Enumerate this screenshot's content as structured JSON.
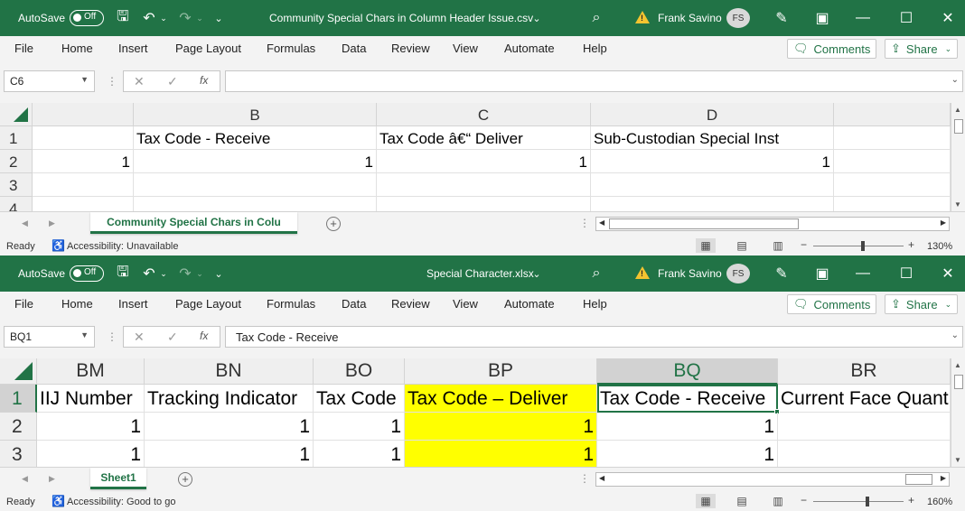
{
  "windows": [
    {
      "autosave_label": "AutoSave",
      "autosave_state": "Off",
      "title": "Community Special Chars in Column Header Issue.csv",
      "user": "Frank Savino",
      "avatar_initials": "FS",
      "menu": [
        "File",
        "Home",
        "Insert",
        "Page Layout",
        "Formulas",
        "Data",
        "Review",
        "View",
        "Automate",
        "Help"
      ],
      "comments_label": "Comments",
      "share_label": "Share",
      "name_box": "C6",
      "formula": "",
      "columns": [
        "B",
        "C",
        "D"
      ],
      "rows": [
        "1",
        "2",
        "3",
        "4"
      ],
      "cells": [
        [
          "",
          "Tax Code - Receive",
          "Tax Code â€“ Deliver",
          "Sub-Custodian Special Inst",
          ""
        ],
        [
          "1",
          "1",
          "1",
          "1",
          ""
        ],
        [
          "",
          "",
          "",
          "",
          ""
        ]
      ],
      "sheet_tab": "Community Special Chars in Colu",
      "status_ready": "Ready",
      "accessibility": "Accessibility: Unavailable",
      "zoom": "130%",
      "zoom_fraction": 0.55
    },
    {
      "autosave_label": "AutoSave",
      "autosave_state": "Off",
      "title": "Special Character.xlsx",
      "user": "Frank Savino",
      "avatar_initials": "FS",
      "menu": [
        "File",
        "Home",
        "Insert",
        "Page Layout",
        "Formulas",
        "Data",
        "Review",
        "View",
        "Automate",
        "Help"
      ],
      "comments_label": "Comments",
      "share_label": "Share",
      "name_box": "BQ1",
      "formula": "Tax Code - Receive",
      "columns": [
        "BM",
        "BN",
        "BO",
        "BP",
        "BQ",
        "BR"
      ],
      "rows": [
        "1",
        "2",
        "3"
      ],
      "cells": [
        [
          "IIJ Number",
          "Tracking Indicator",
          "Tax Code",
          "Tax Code – Deliver",
          "Tax Code - Receive",
          "Current Face Quanti"
        ],
        [
          "1",
          "1",
          "1",
          "1",
          "1",
          ""
        ],
        [
          "1",
          "1",
          "1",
          "1",
          "1",
          ""
        ]
      ],
      "sheet_tab": "Sheet1",
      "status_ready": "Ready",
      "accessibility": "Accessibility: Good to go",
      "zoom": "160%",
      "zoom_fraction": 0.6,
      "highlight_color": "#ffff00"
    }
  ],
  "colors": {
    "excel_green": "#217346"
  }
}
